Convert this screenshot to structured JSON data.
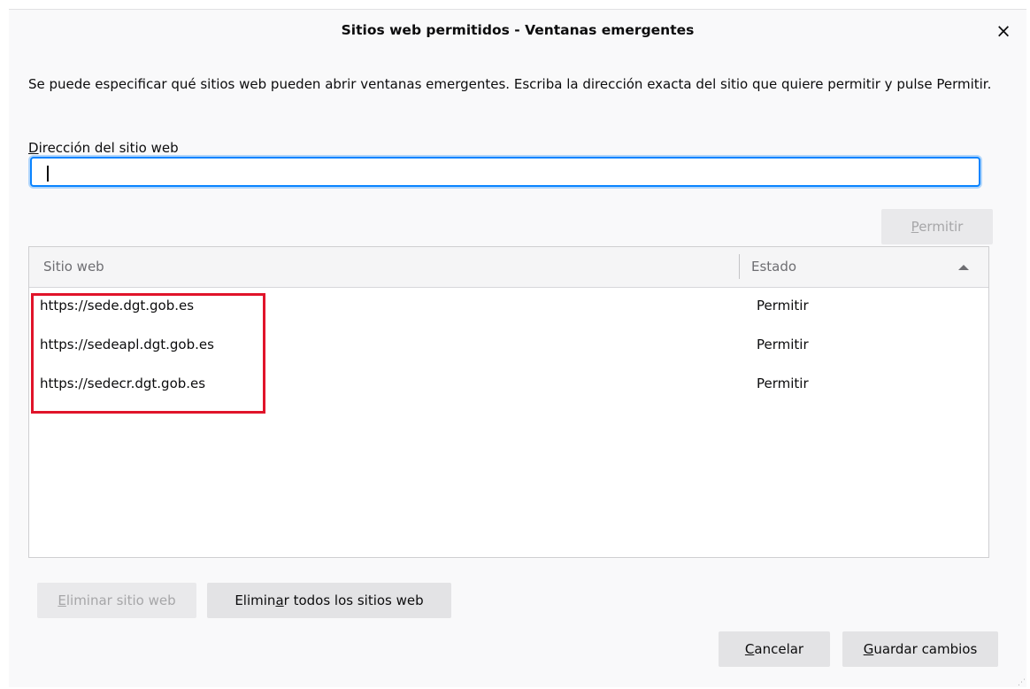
{
  "dialog": {
    "title": "Sitios web permitidos - Ventanas emergentes",
    "close_icon": "×",
    "description": "Se puede especificar qué sitios web pueden abrir ventanas emergentes. Escriba la dirección exacta del sitio que quiere permitir y pulse Permitir.",
    "address_label_key": "D",
    "address_label_rest": "irección del sitio web",
    "address_value": "",
    "allow_button": {
      "key": "P",
      "rest": "ermitir",
      "disabled": true
    }
  },
  "table": {
    "columns": [
      "Sitio web",
      "Estado"
    ],
    "sort": "ascending",
    "rows": [
      {
        "site": "https://sede.dgt.gob.es",
        "status": "Permitir"
      },
      {
        "site": "https://sedeapl.dgt.gob.es",
        "status": "Permitir"
      },
      {
        "site": "https://sedecr.dgt.gob.es",
        "status": "Permitir"
      }
    ]
  },
  "buttons": {
    "remove_site": {
      "key": "E",
      "rest": "liminar sitio web",
      "disabled": true
    },
    "remove_all": {
      "pre": "Elimin",
      "key": "a",
      "rest": "r todos los sitios web"
    },
    "cancel": {
      "key": "C",
      "rest": "ancelar"
    },
    "save": {
      "key": "G",
      "rest": "uardar cambios"
    }
  },
  "colors": {
    "focus": "#0a84ff",
    "highlight": "#e0142a"
  }
}
